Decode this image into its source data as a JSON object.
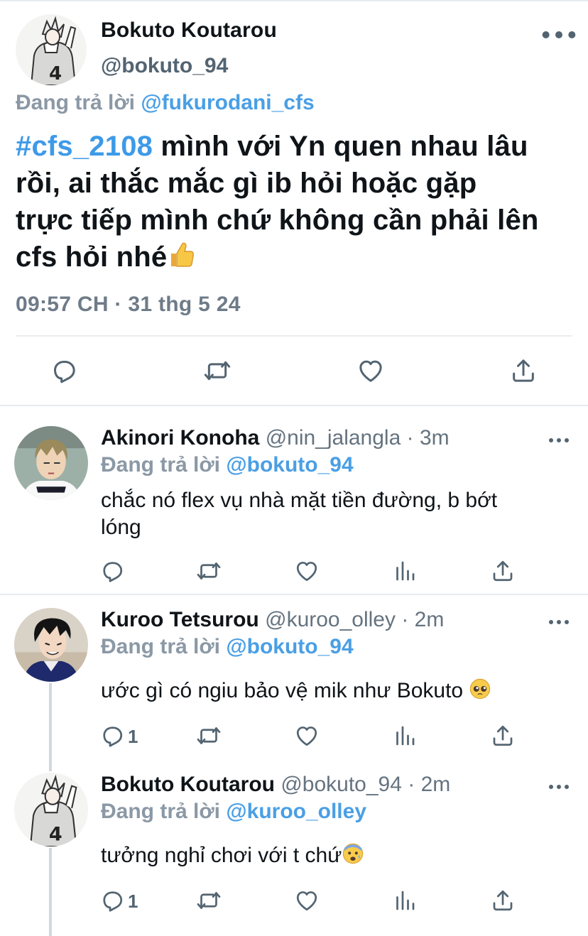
{
  "main_tweet": {
    "author": {
      "name": "Bokuto Koutarou",
      "handle": "@bokuto_94"
    },
    "replying_prefix": "Đang trả lời",
    "replying_to": "@fukurodani_cfs",
    "hashtag": "#cfs_2108",
    "text_line1": " mình với Yn quen nhau lâu",
    "text_line2": "rồi, ai thắc mắc gì ib hỏi hoặc gặp",
    "text_line3": "trực tiếp mình chứ không cần phải lên",
    "text_line4": "cfs hỏi nhé",
    "emoji": "thumbs-up",
    "timestamp": "09:57 CH · 31 thg 5 24",
    "actions": [
      "reply-icon",
      "retweet-icon",
      "like-icon",
      "share-icon"
    ]
  },
  "replies": [
    {
      "author": {
        "name": "Akinori Konoha",
        "handle": "@nin_jalangla"
      },
      "time": "· 3m",
      "replying_prefix": "Đang trả lời",
      "replying_to": "@bokuto_94",
      "text_line1": "chắc nó flex vụ nhà mặt tiền đường, b bớt",
      "text_line2": "lóng",
      "reply_count": ""
    },
    {
      "author": {
        "name": "Kuroo Tetsurou",
        "handle": "@kuroo_olley"
      },
      "time": "· 2m",
      "replying_prefix": "Đang trả lời",
      "replying_to": "@bokuto_94",
      "text_line1": "ước gì có ngiu bảo vệ mik như Bokuto",
      "emoji": "pleading-face",
      "reply_count": "1"
    },
    {
      "author": {
        "name": "Bokuto Koutarou",
        "handle": "@bokuto_94"
      },
      "time": "· 2m",
      "replying_prefix": "Đang trả lời",
      "replying_to": "@kuroo_olley",
      "text_line1": "tưởng nghỉ chơi với t chứ",
      "emoji": "anxious-face",
      "reply_count": "1"
    }
  ],
  "colors": {
    "link": "#4a9fe5",
    "hashtag": "#3d9ae8",
    "muted": "#8b98a5",
    "icon": "#536471",
    "divider": "#e6ecf0"
  }
}
